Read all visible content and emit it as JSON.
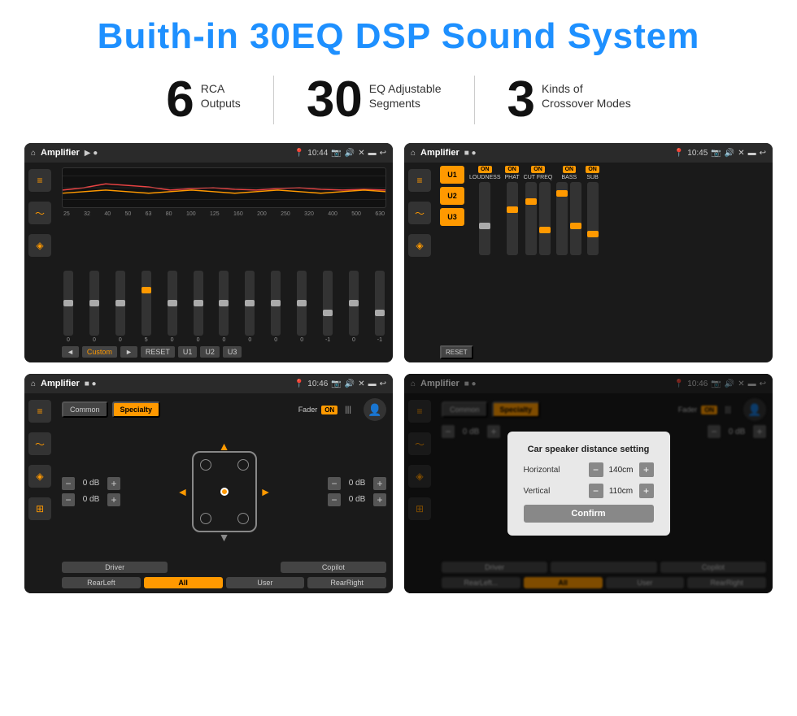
{
  "header": {
    "title": "Buith-in 30EQ DSP Sound System"
  },
  "stats": [
    {
      "number": "6",
      "label": "RCA\nOutputs"
    },
    {
      "number": "30",
      "label": "EQ Adjustable\nSegments"
    },
    {
      "number": "3",
      "label": "Kinds of\nCrossover Modes"
    }
  ],
  "screen1": {
    "topbar": {
      "app": "Amplifier",
      "time": "10:44"
    },
    "freq_labels": [
      "25",
      "32",
      "40",
      "50",
      "63",
      "80",
      "100",
      "125",
      "160",
      "200",
      "250",
      "320",
      "400",
      "500",
      "630"
    ],
    "slider_vals": [
      "0",
      "0",
      "0",
      "5",
      "0",
      "0",
      "0",
      "0",
      "0",
      "0",
      "-1",
      "0",
      "-1"
    ],
    "buttons": [
      "◄",
      "Custom",
      "►",
      "RESET",
      "U1",
      "U2",
      "U3"
    ]
  },
  "screen2": {
    "topbar": {
      "app": "Amplifier",
      "time": "10:45"
    },
    "u_buttons": [
      "U1",
      "U2",
      "U3"
    ],
    "channels": [
      {
        "on": true,
        "label": "LOUDNESS"
      },
      {
        "on": true,
        "label": "PHAT"
      },
      {
        "on": true,
        "label": "CUT FREQ"
      },
      {
        "on": true,
        "label": "BASS"
      },
      {
        "on": true,
        "label": "SUB"
      }
    ],
    "reset_label": "RESET"
  },
  "screen3": {
    "topbar": {
      "app": "Amplifier",
      "time": "10:46"
    },
    "common_label": "Common",
    "specialty_label": "Specialty",
    "fader_label": "Fader",
    "on_label": "ON",
    "db_values": [
      "0 dB",
      "0 dB",
      "0 dB",
      "0 dB"
    ],
    "bottom_buttons": [
      "Driver",
      "",
      "Copilot",
      "RearLeft",
      "All",
      "User",
      "RearRight"
    ]
  },
  "screen4": {
    "topbar": {
      "app": "Amplifier",
      "time": "10:46"
    },
    "common_label": "Common",
    "specialty_label": "Specialty",
    "dialog": {
      "title": "Car speaker distance setting",
      "horizontal_label": "Horizontal",
      "horizontal_value": "140cm",
      "vertical_label": "Vertical",
      "vertical_value": "110cm",
      "confirm_label": "Confirm"
    },
    "db_values": [
      "0 dB",
      "0 dB"
    ],
    "bottom_buttons": [
      "Driver",
      "Copilot",
      "RearLeft",
      "User",
      "RearRight"
    ]
  }
}
